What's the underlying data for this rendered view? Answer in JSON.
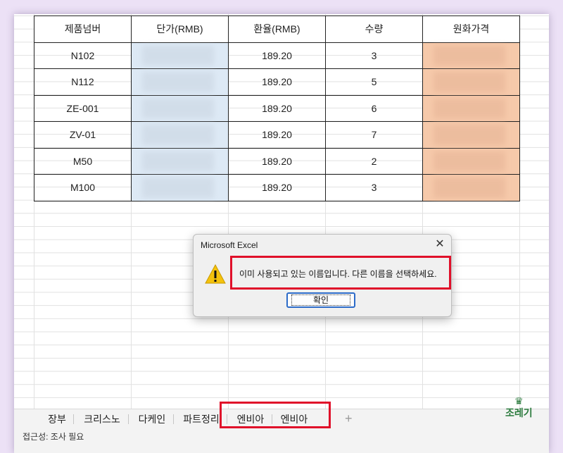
{
  "table": {
    "headers": [
      "제품넘버",
      "단가(RMB)",
      "환율(RMB)",
      "수량",
      "원화가격"
    ],
    "rows": [
      {
        "product": "N102",
        "rate": "189.20",
        "qty": "3"
      },
      {
        "product": "N112",
        "rate": "189.20",
        "qty": "5"
      },
      {
        "product": "ZE-001",
        "rate": "189.20",
        "qty": "6"
      },
      {
        "product": "ZV-01",
        "rate": "189.20",
        "qty": "7"
      },
      {
        "product": "M50",
        "rate": "189.20",
        "qty": "2"
      },
      {
        "product": "M100",
        "rate": "189.20",
        "qty": "3"
      }
    ]
  },
  "dialog": {
    "title": "Microsoft Excel",
    "close_glyph": "✕",
    "message": "이미 사용되고 있는 이름입니다. 다른 이름을 선택하세요.",
    "ok_label": "확인",
    "icon": "warning-icon"
  },
  "sheet_tabs": [
    "장부",
    "크리스노",
    "다케인",
    "파트정리",
    "엔비아",
    "엔비아"
  ],
  "active_tab": "엔비아",
  "add_sheet_glyph": "+",
  "status": {
    "text": "접근성: 조사 필요"
  },
  "brand": {
    "name": "조레기"
  },
  "colors": {
    "highlight": "#e0102a",
    "price_fill": "#dde9f5",
    "krw_fill": "#f6c9aa",
    "excel_green": "#1e6b3a"
  }
}
